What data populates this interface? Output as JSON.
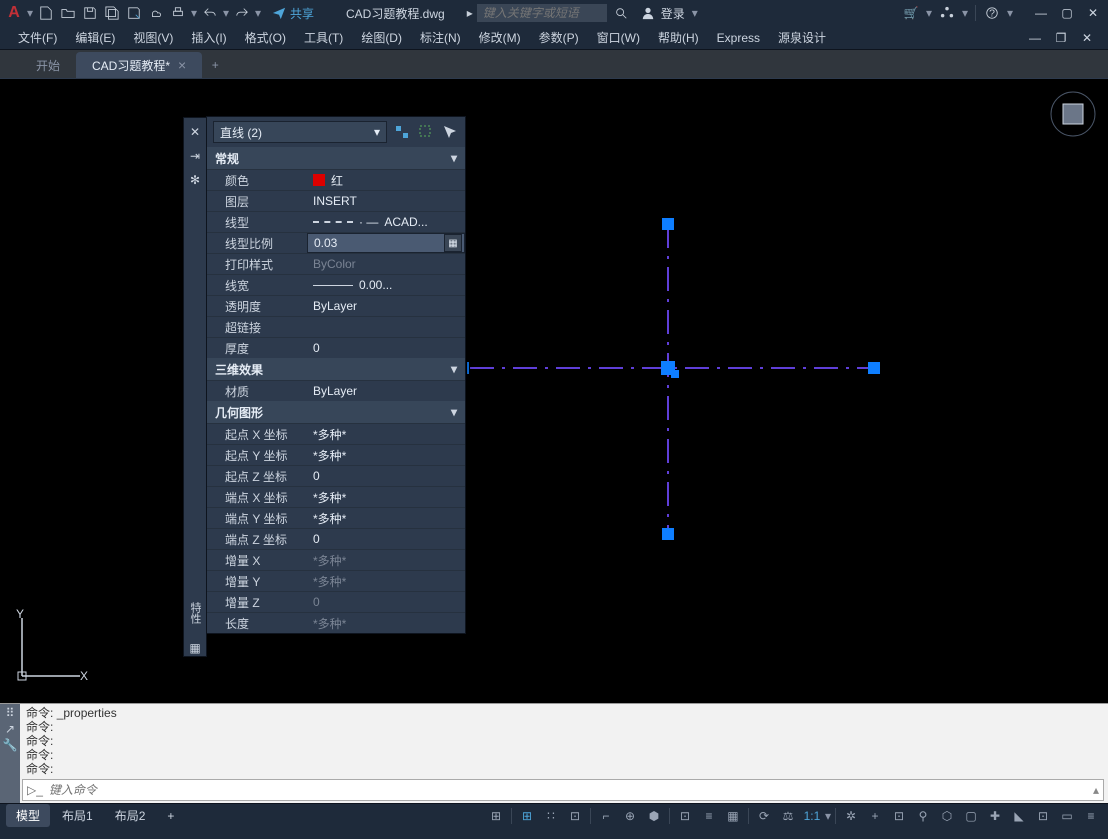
{
  "title": {
    "doc": "CAD习题教程.dwg",
    "share": "共享",
    "login": "登录",
    "search_ph": "键入关键字或短语"
  },
  "menus": [
    "文件(F)",
    "编辑(E)",
    "视图(V)",
    "插入(I)",
    "格式(O)",
    "工具(T)",
    "绘图(D)",
    "标注(N)",
    "修改(M)",
    "参数(P)",
    "窗口(W)",
    "帮助(H)",
    "Express",
    "源泉设计"
  ],
  "tabs": {
    "start": "开始",
    "active": "CAD习题教程*"
  },
  "props": {
    "selector": "直线 (2)",
    "sections": {
      "general": "常规",
      "threed": "三维效果",
      "geom": "几何图形"
    },
    "rows": {
      "color_l": "颜色",
      "color_v": "红",
      "layer_l": "图层",
      "layer_v": "INSERT",
      "ltype_l": "线型",
      "ltype_v": "ACAD...",
      "ltscale_l": "线型比例",
      "ltscale_v": "0.03",
      "plot_l": "打印样式",
      "plot_v": "ByColor",
      "lw_l": "线宽",
      "lw_v": "0.00...",
      "transp_l": "透明度",
      "transp_v": "ByLayer",
      "hyper_l": "超链接",
      "hyper_v": "",
      "thick_l": "厚度",
      "thick_v": "0",
      "mat_l": "材质",
      "mat_v": "ByLayer",
      "sx_l": "起点 X 坐标",
      "sx_v": "*多种*",
      "sy_l": "起点 Y 坐标",
      "sy_v": "*多种*",
      "sz_l": "起点 Z 坐标",
      "sz_v": "0",
      "ex_l": "端点 X 坐标",
      "ex_v": "*多种*",
      "ey_l": "端点 Y 坐标",
      "ey_v": "*多种*",
      "ez_l": "端点 Z 坐标",
      "ez_v": "0",
      "dx_l": "增量 X",
      "dx_v": "*多种*",
      "dy_l": "增量 Y",
      "dy_v": "*多种*",
      "dz_l": "增量 Z",
      "dz_v": "0",
      "len_l": "长度",
      "len_v": "*多种*"
    },
    "handle_label": "特性"
  },
  "cmd": {
    "l1": "命令:",
    "l1b": "_properties",
    "l2": "命令:",
    "l3": "命令:",
    "l4": "命令:",
    "l5": "命令:",
    "input_ph": "键入命令"
  },
  "status": {
    "model": "模型",
    "layout1": "布局1",
    "layout2": "布局2",
    "scale": "1:1"
  },
  "ucs": {
    "x": "X",
    "y": "Y"
  }
}
